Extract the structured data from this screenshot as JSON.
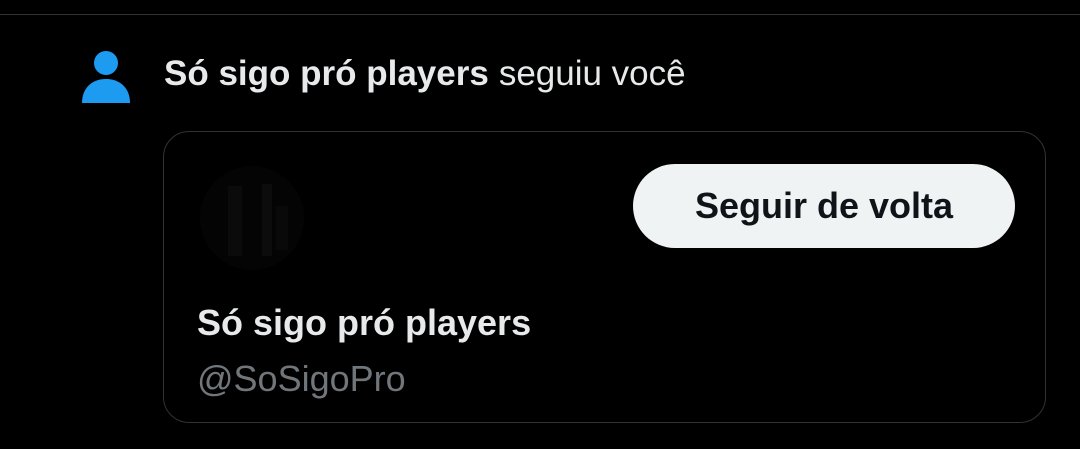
{
  "colors": {
    "background": "#000000",
    "text_primary": "#e7e9ea",
    "text_secondary": "#71767b",
    "border": "#2f3336",
    "accent_icon": "#1d9bf0",
    "button_bg": "#eff3f4",
    "button_text": "#0f1419"
  },
  "notification": {
    "icon": "person-icon",
    "user_name": "Só sigo pró players",
    "action_text": "seguiu você"
  },
  "user_card": {
    "avatar": "avatar",
    "display_name": "Só sigo pró players",
    "handle": "@SoSigoPro",
    "follow_back_label": "Seguir de volta"
  }
}
